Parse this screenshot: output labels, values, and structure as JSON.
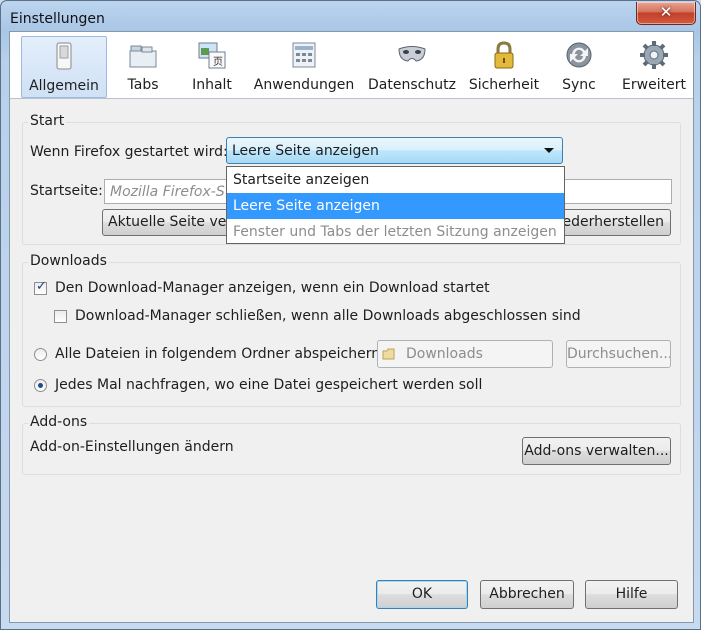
{
  "window": {
    "title": "Einstellungen",
    "close_glyph": "✕"
  },
  "toolbar": {
    "items": [
      {
        "label": "Allgemein",
        "icon": "switch-icon"
      },
      {
        "label": "Tabs",
        "icon": "tabs-icon"
      },
      {
        "label": "Inhalt",
        "icon": "content-icon"
      },
      {
        "label": "Anwendungen",
        "icon": "applications-icon"
      },
      {
        "label": "Datenschutz",
        "icon": "privacy-mask-icon"
      },
      {
        "label": "Sicherheit",
        "icon": "lock-icon"
      },
      {
        "label": "Sync",
        "icon": "sync-icon"
      },
      {
        "label": "Erweitert",
        "icon": "gear-icon"
      }
    ],
    "active": "Allgemein"
  },
  "start": {
    "group_label": "Start",
    "when_label": "Wenn Firefox gestartet wird:",
    "selected": "Leere Seite anzeigen",
    "options": [
      {
        "label": "Startseite anzeigen",
        "state": "normal"
      },
      {
        "label": "Leere Seite anzeigen",
        "state": "selected"
      },
      {
        "label": "Fenster und Tabs der letzten Sitzung anzeigen",
        "state": "disabled"
      }
    ],
    "homepage_label": "Startseite:",
    "homepage_placeholder": "Mozilla Firefox-Startseite",
    "current_page_button": "Aktuelle Seite verwenden",
    "restore_button": "Standard wiederherstellen"
  },
  "downloads": {
    "group_label": "Downloads",
    "show_manager": "Den Download-Manager anzeigen, wenn ein Download startet",
    "show_manager_checked": true,
    "close_manager": "Download-Manager schließen, wenn alle Downloads abgeschlossen sind",
    "close_manager_checked": false,
    "save_all": "Alle Dateien in folgendem Ordner abspeichern:",
    "folder": "Downloads",
    "browse_button": "Durchsuchen...",
    "ask_each": "Jedes Mal nachfragen, wo eine Datei gespeichert werden soll",
    "selected_option": "ask_each"
  },
  "addons": {
    "group_label": "Add-ons",
    "text": "Add-on-Einstellungen ändern",
    "manage_button": "Add-ons verwalten..."
  },
  "footer": {
    "ok": "OK",
    "cancel": "Abbrechen",
    "help": "Hilfe"
  }
}
